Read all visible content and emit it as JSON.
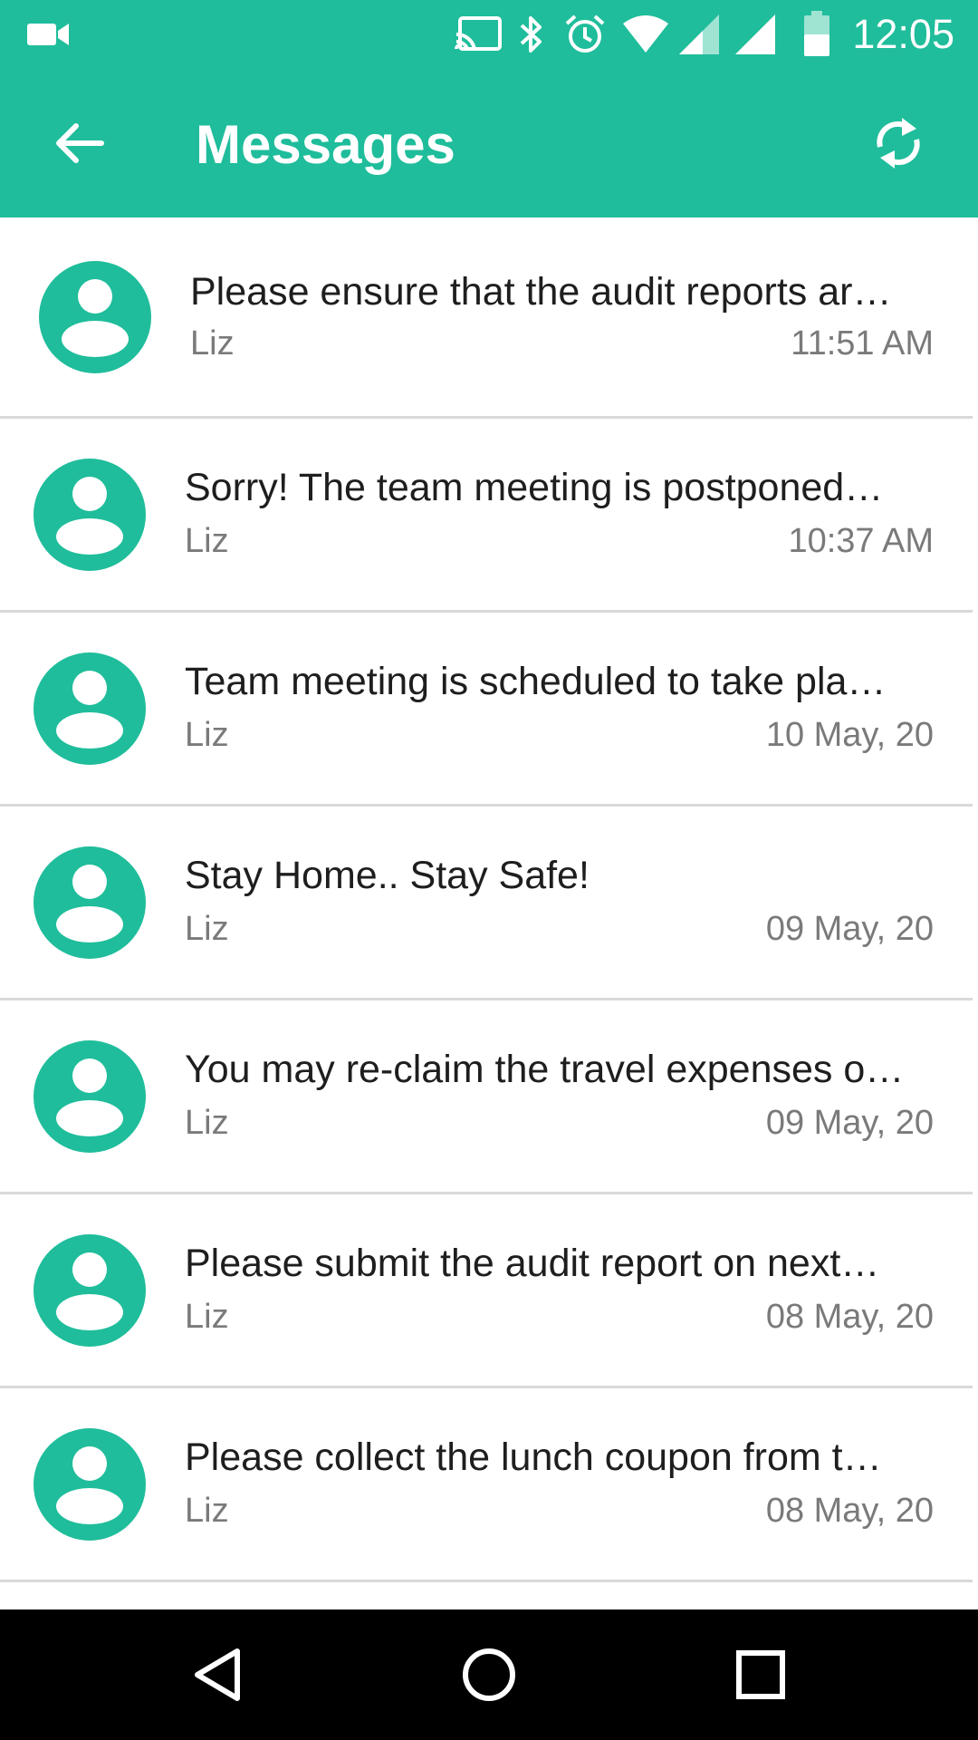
{
  "status_bar": {
    "time": "12:05",
    "icons": [
      "video-camera-icon",
      "cast-icon",
      "bluetooth-icon",
      "alarm-icon",
      "wifi-icon",
      "signal-icon",
      "signal-icon",
      "battery-icon"
    ]
  },
  "app_bar": {
    "title": "Messages",
    "back_icon": "arrow-left-icon",
    "refresh_icon": "refresh-icon"
  },
  "messages": [
    {
      "title": "Please ensure that the audit reports ar…",
      "sender": "Liz",
      "time": "11:51 AM"
    },
    {
      "title": "Sorry! The team meeting is postponed…",
      "sender": "Liz",
      "time": "10:37 AM"
    },
    {
      "title": "Team meeting is scheduled to take pla…",
      "sender": "Liz",
      "time": "10 May, 20"
    },
    {
      "title": "Stay Home.. Stay Safe!",
      "sender": "Liz",
      "time": "09 May, 20"
    },
    {
      "title": "You may re-claim the travel expenses o…",
      "sender": "Liz",
      "time": "09 May, 20"
    },
    {
      "title": "Please submit the audit report on next…",
      "sender": "Liz",
      "time": "08 May, 20"
    },
    {
      "title": "Please collect the lunch coupon from t…",
      "sender": "Liz",
      "time": "08 May, 20"
    }
  ],
  "nav_bar": {
    "icons": [
      "back-triangle-icon",
      "home-circle-icon",
      "recents-square-icon"
    ]
  },
  "colors": {
    "accent": "#1fbd9b",
    "text_primary": "#1e1e1e",
    "text_secondary": "#7a7a7a"
  }
}
